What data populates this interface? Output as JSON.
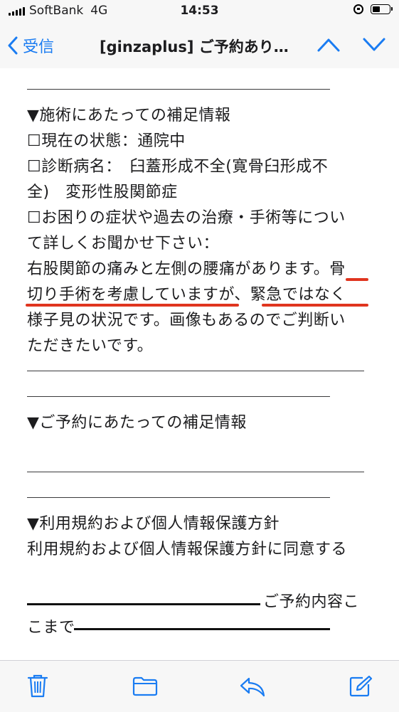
{
  "status_bar": {
    "carrier": "SoftBank",
    "network": "4G",
    "time": "14:53"
  },
  "nav": {
    "back_label": "受信",
    "title": "[ginzaplus] ご予約あり…",
    "icons": [
      "chevron-left-icon",
      "chevron-up-icon",
      "chevron-down-icon"
    ]
  },
  "body": {
    "section1": {
      "heading": "▼施術にあたっての補足情報",
      "status_line": "☐現在の状態：通院中",
      "diagnosis_line1": "☐診断病名：　臼蓋形成不全(寛骨臼形成不",
      "diagnosis_line2": "全)　変形性股関節症",
      "question_line1": "☐お困りの症状や過去の治療・手術等につい",
      "question_line2": "て詳しくお聞かせ下さい：",
      "answer_line1": "右股関節の痛みと左側の腰痛があります。骨",
      "answer_line2": "切り手術を考慮していますが、緊急ではなく",
      "answer_line3": "様子見の状況です。画像もあるのでご判断い",
      "answer_line4": "ただきたいです。"
    },
    "section2": {
      "heading": "▼ご予約にあたっての補足情報"
    },
    "section3": {
      "heading": "▼利用規約および個人情報保護方針",
      "agreement": "利用規約および個人情報保護方針に同意する"
    },
    "footer_line1": "ご予約内容こ",
    "footer_line2": "こまで"
  },
  "toolbar": {
    "icons": [
      "trash-icon",
      "folder-icon",
      "reply-icon",
      "compose-icon"
    ],
    "accent": "#1a7cf2"
  },
  "colors": {
    "accent": "#1a7cf2",
    "highlight_underline": "#e0351f"
  }
}
